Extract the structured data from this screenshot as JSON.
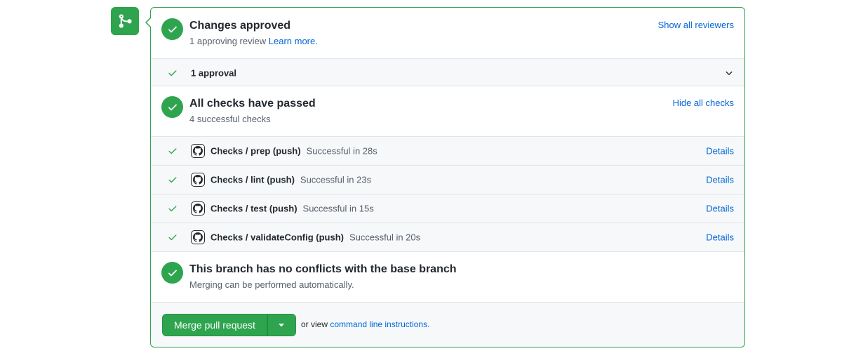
{
  "reviews": {
    "title": "Changes approved",
    "subtitle_prefix": "1 approving review",
    "learn_more": "Learn more.",
    "show_all_reviewers": "Show all reviewers",
    "approval_summary": "1 approval"
  },
  "checks": {
    "title": "All checks have passed",
    "subtitle": "4 successful checks",
    "hide_all_checks": "Hide all checks",
    "details_label": "Details",
    "items": [
      {
        "name": "Checks / prep (push)",
        "status": "Successful in 28s"
      },
      {
        "name": "Checks / lint (push)",
        "status": "Successful in 23s"
      },
      {
        "name": "Checks / test (push)",
        "status": "Successful in 15s"
      },
      {
        "name": "Checks / validateConfig (push)",
        "status": "Successful in 20s"
      }
    ]
  },
  "conflicts": {
    "title": "This branch has no conflicts with the base branch",
    "subtitle": "Merging can be performed automatically."
  },
  "merge": {
    "button_label": "Merge pull request",
    "or_view": "or view",
    "cli_link": "command line instructions."
  },
  "colors": {
    "success": "#2ea44f",
    "link": "#0366d6",
    "muted": "#586069",
    "row_bg": "#f6f8fa"
  },
  "icons": {
    "merge": "git-merge-icon",
    "status": "check-circle-icon",
    "row_check": "check-icon",
    "avatar": "github-mark-icon",
    "expand": "chevron-down-icon",
    "dropdown": "triangle-down-icon"
  }
}
